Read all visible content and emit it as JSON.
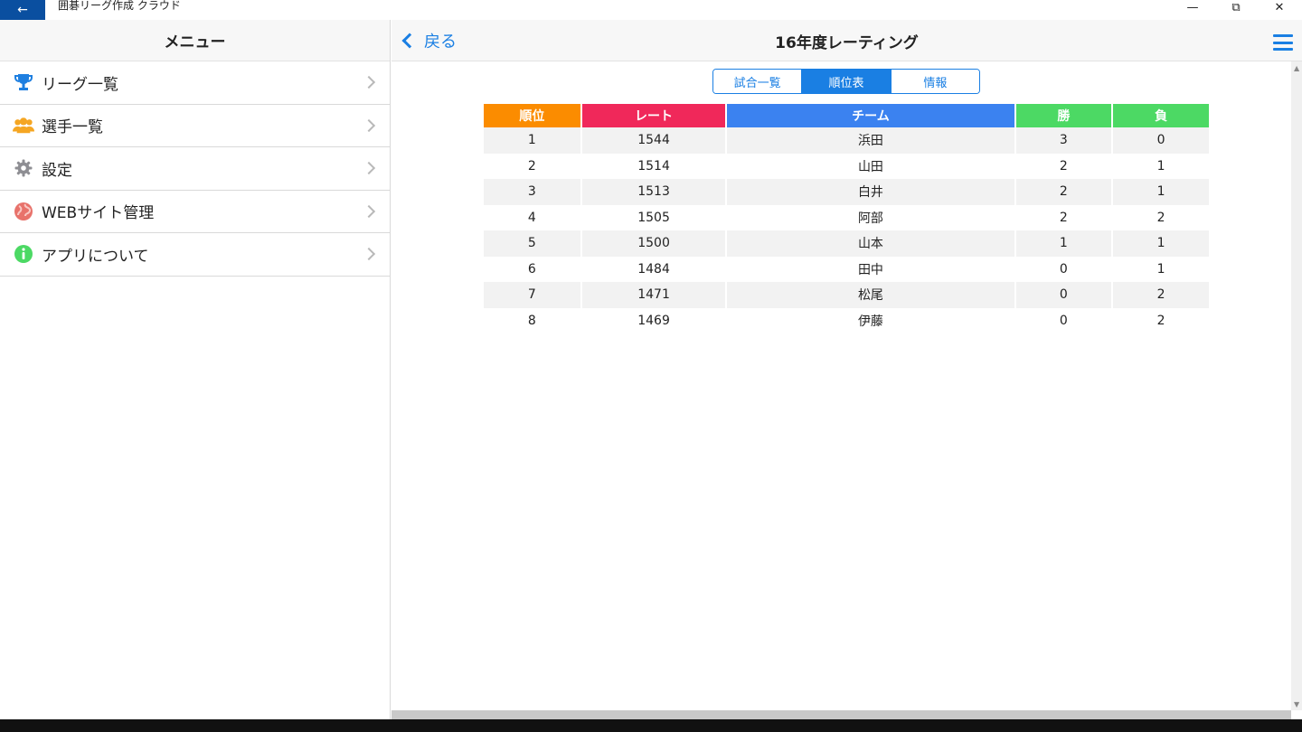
{
  "window": {
    "app_title": "囲碁リーグ作成 クラウド",
    "back_icon": "←",
    "minimize": "—",
    "restore": "⧉",
    "close": "✕"
  },
  "sidebar": {
    "title": "メニュー",
    "items": [
      {
        "label": "リーグ一覧",
        "icon": "trophy-icon"
      },
      {
        "label": "選手一覧",
        "icon": "users-icon"
      },
      {
        "label": "設定",
        "icon": "gear-icon"
      },
      {
        "label": "WEBサイト管理",
        "icon": "globe-icon"
      },
      {
        "label": "アプリについて",
        "icon": "info-icon"
      }
    ]
  },
  "header": {
    "back_label": "戻る",
    "title": "16年度レーティング"
  },
  "tabs": [
    {
      "label": "試合一覧",
      "active": false
    },
    {
      "label": "順位表",
      "active": true
    },
    {
      "label": "情報",
      "active": false
    }
  ],
  "standings": {
    "columns": [
      {
        "label": "順位",
        "color": "#fb8c00"
      },
      {
        "label": "レート",
        "color": "#f0285a"
      },
      {
        "label": "チーム",
        "color": "#3b82f0"
      },
      {
        "label": "勝",
        "color": "#4cd964"
      },
      {
        "label": "負",
        "color": "#4cd964"
      }
    ],
    "rows": [
      [
        "1",
        "1544",
        "浜田",
        "3",
        "0"
      ],
      [
        "2",
        "1514",
        "山田",
        "2",
        "1"
      ],
      [
        "3",
        "1513",
        "白井",
        "2",
        "1"
      ],
      [
        "4",
        "1505",
        "阿部",
        "2",
        "2"
      ],
      [
        "5",
        "1500",
        "山本",
        "1",
        "1"
      ],
      [
        "6",
        "1484",
        "田中",
        "0",
        "1"
      ],
      [
        "7",
        "1471",
        "松尾",
        "0",
        "2"
      ],
      [
        "8",
        "1469",
        "伊藤",
        "0",
        "2"
      ]
    ]
  }
}
